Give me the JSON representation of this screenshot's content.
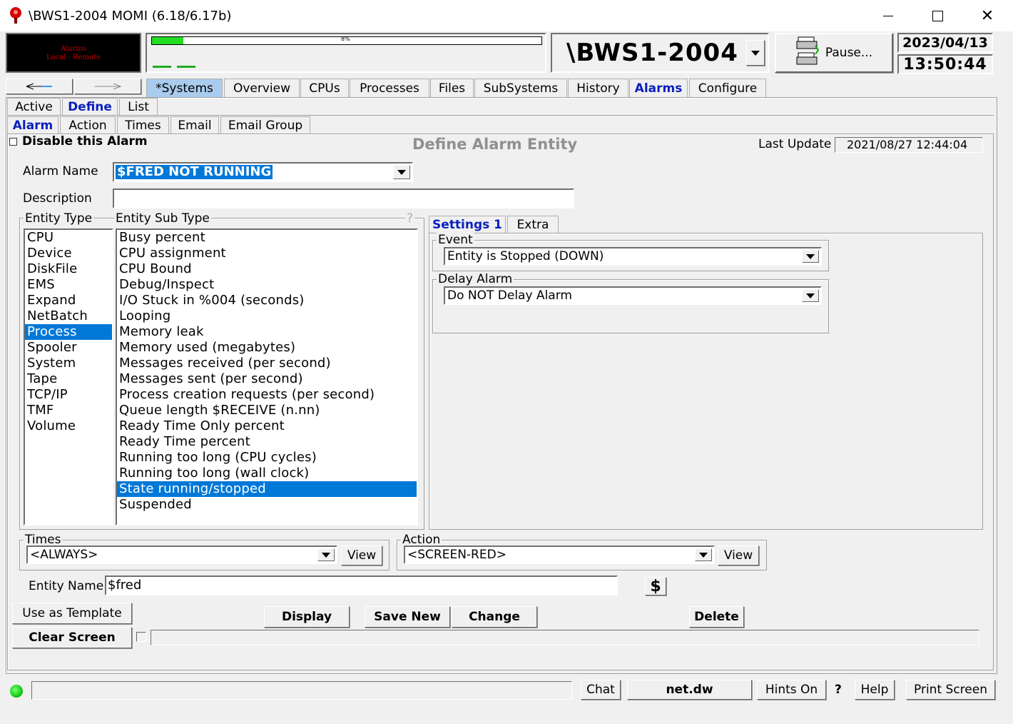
{
  "window": {
    "title": "\\BWS1-2004 MOMI (6.18/6.17b)"
  },
  "top": {
    "alarm_badge": [
      "Alarms",
      "Local - Remote"
    ],
    "progress_text": "8%",
    "progress_fraction": 0.08,
    "system_name": "\\BWS1-2004",
    "pause_label": "Pause...",
    "date": "2023/04/13",
    "time": "13:50:44"
  },
  "main_tabs": [
    "*Systems",
    "Overview",
    "CPUs",
    "Processes",
    "Files",
    "SubSystems",
    "History",
    "Alarms",
    "Configure"
  ],
  "sub_tabs": [
    "Active",
    "Define",
    "List"
  ],
  "sub_tabs2": [
    "Alarm",
    "Action",
    "Times",
    "Email",
    "Email Group"
  ],
  "form": {
    "disable_label": "Disable this Alarm",
    "heading": "Define Alarm Entity",
    "last_update_label": "Last Update",
    "last_update_value": "2021/08/27 12:44:04",
    "alarm_name_label": "Alarm Name",
    "alarm_name_value": "$FRED NOT RUNNING",
    "description_label": "Description",
    "description_value": "",
    "entity_type_label": "Entity Type",
    "entity_sub_type_label": "Entity Sub Type",
    "help_mark": "?",
    "entity_types": [
      "CPU",
      "Device",
      "DiskFile",
      "EMS",
      "Expand",
      "NetBatch",
      "Process",
      "Spooler",
      "System",
      "Tape",
      "TCP/IP",
      "TMF",
      "Volume"
    ],
    "entity_type_selected": "Process",
    "entity_sub_types": [
      "Busy percent",
      "CPU assignment",
      "CPU Bound",
      "Debug/Inspect",
      "I/O Stuck in %004 (seconds)",
      "Looping",
      "Memory leak",
      "Memory used (megabytes)",
      "Messages received (per second)",
      "Messages sent (per second)",
      "Process creation requests (per second)",
      "Queue length $RECEIVE (n.nn)",
      "Ready Time Only percent",
      "Ready Time percent",
      "Running too long (CPU cycles)",
      "Running too long (wall clock)",
      "State running/stopped",
      "Suspended"
    ],
    "entity_sub_type_selected": "State running/stopped",
    "settings_tabs": [
      "Settings 1",
      "Extra"
    ],
    "event_label": "Event",
    "event_value": "Entity is Stopped (DOWN)",
    "delay_label": "Delay Alarm",
    "delay_value": "Do NOT Delay Alarm",
    "times_label": "Times",
    "times_value": "<ALWAYS>",
    "action_label": "Action",
    "action_value": "<SCREEN-RED>",
    "view_label": "View",
    "entity_name_label": "Entity Name",
    "entity_name_value": "$fred",
    "dollar_icon": "$"
  },
  "buttons": {
    "use_as_template": "Use as Template",
    "clear_screen": "Clear Screen",
    "display": "Display",
    "save_new": "Save New",
    "change": "Change",
    "delete": "Delete"
  },
  "status": {
    "chat": "Chat",
    "file": "net.dw",
    "hints": "Hints On",
    "question": "?",
    "help": "Help",
    "print": "Print Screen"
  },
  "colors": {
    "accent": "#0a1fbf",
    "selection": "#0078d7",
    "alarm_red": "#c00000",
    "status_green": "#22cc22"
  }
}
